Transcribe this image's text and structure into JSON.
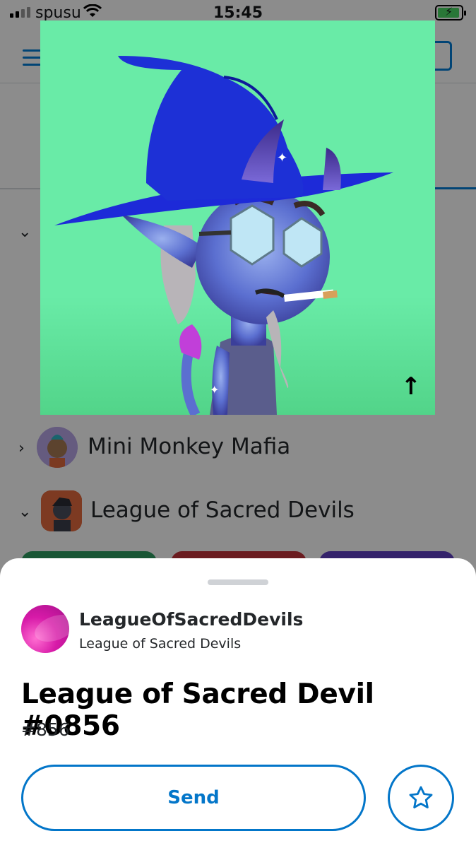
{
  "status_bar": {
    "carrier": "spusu",
    "time": "15:45"
  },
  "collections": [
    {
      "name": ""
    },
    {
      "name": "Mini Monkey Mafia"
    },
    {
      "name": "League of Sacred Devils"
    }
  ],
  "nft_overlay": {
    "background_color": "#69eba7",
    "share_icon": "arrow-up-icon"
  },
  "sheet": {
    "collection_handle": "LeagueOfSacredDevils",
    "collection_name": "League of Sacred Devils",
    "nft_title": "League of Sacred Devil #0856",
    "nft_id": "#856",
    "send_label": "Send",
    "favorite_icon": "star-icon"
  },
  "colors": {
    "accent": "#0376c9",
    "avatar": "#d71aa8"
  }
}
